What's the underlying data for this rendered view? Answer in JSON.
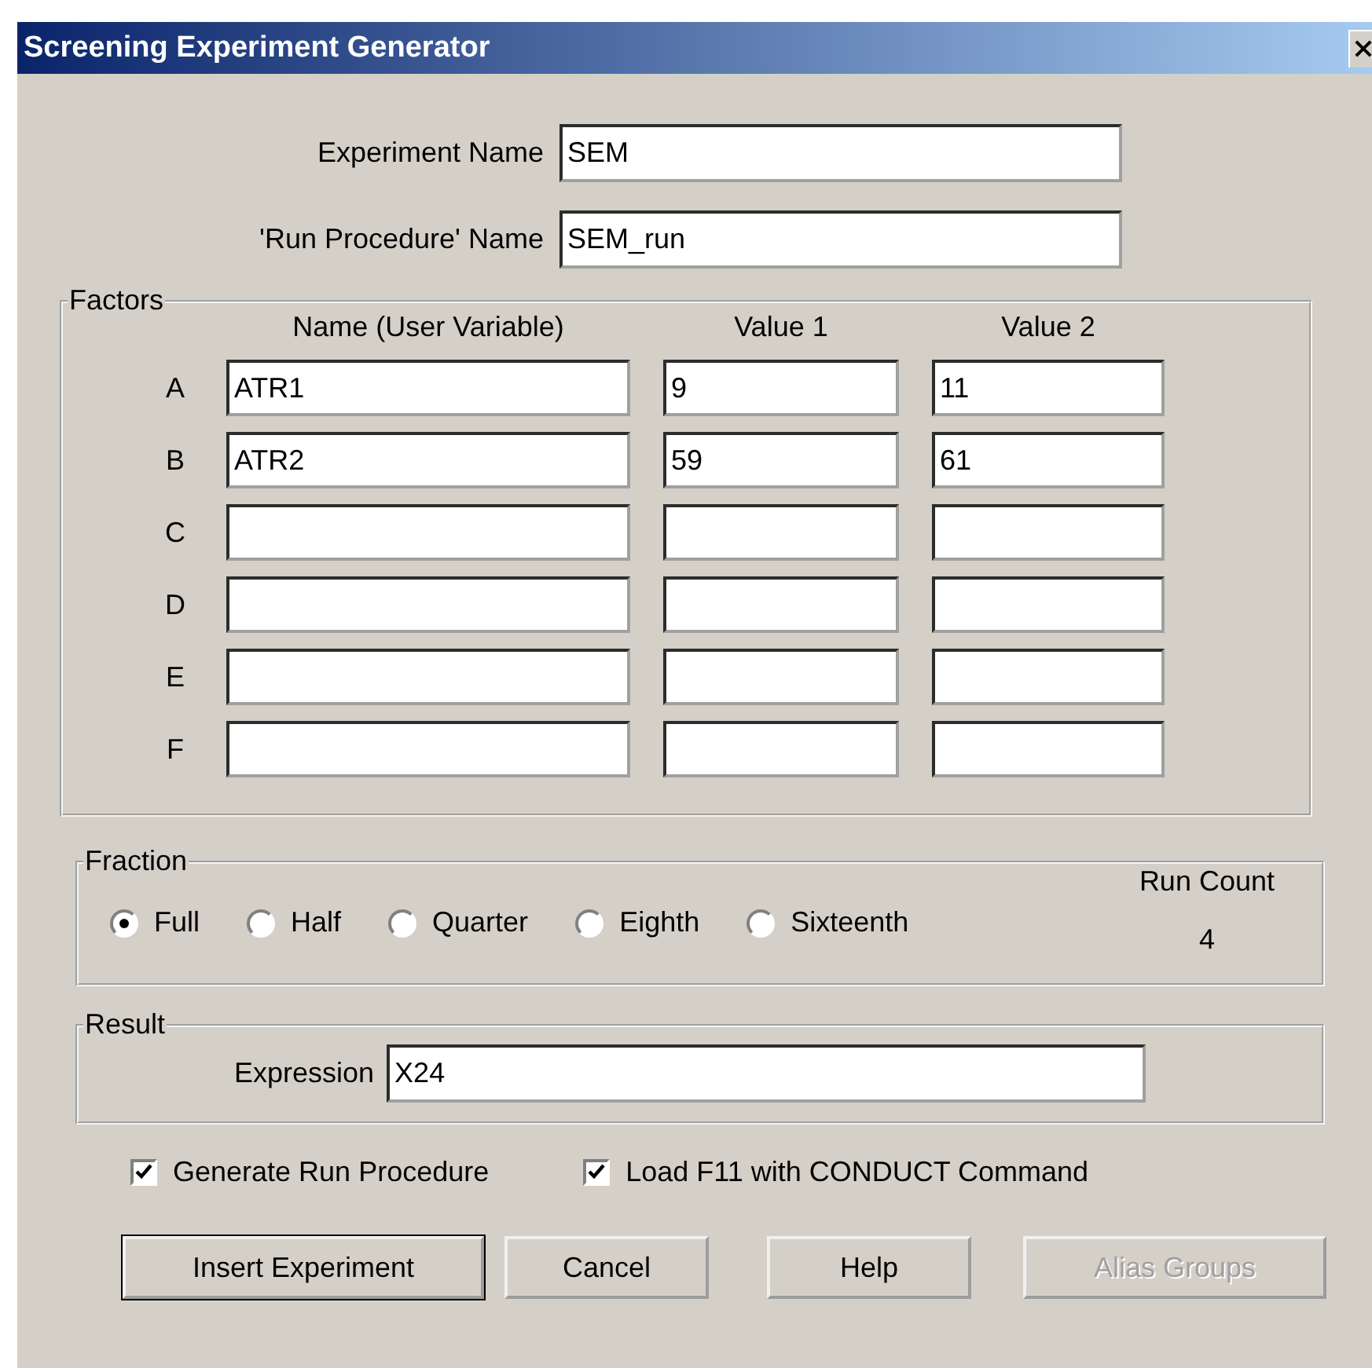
{
  "window": {
    "title": "Screening Experiment Generator"
  },
  "experiment_name": {
    "label": "Experiment Name",
    "value": "SEM"
  },
  "run_procedure_name": {
    "label": "'Run Procedure' Name",
    "value": "SEM_run"
  },
  "factors": {
    "title": "Factors",
    "columns": [
      "Name (User Variable)",
      "Value 1",
      "Value 2"
    ],
    "rows": [
      {
        "letter": "A",
        "name": "ATR1",
        "value_1": "9",
        "value_2": "11"
      },
      {
        "letter": "B",
        "name": "ATR2",
        "value_1": "59",
        "value_2": "61"
      },
      {
        "letter": "C"
      },
      {
        "letter": "D"
      },
      {
        "letter": "E"
      },
      {
        "letter": "F"
      }
    ]
  },
  "fraction": {
    "title": "Fraction",
    "options": [
      {
        "label": "Full",
        "selected": true
      },
      {
        "label": "Half",
        "selected": false
      },
      {
        "label": "Quarter",
        "selected": false
      },
      {
        "label": "Eighth",
        "selected": false
      },
      {
        "label": "Sixteenth",
        "selected": false
      }
    ],
    "run_count": {
      "label": "Run Count",
      "value": "4"
    }
  },
  "result": {
    "title": "Result",
    "expression": {
      "label": "Expression",
      "value": "X24"
    }
  },
  "options": [
    {
      "label": "Generate Run Procedure",
      "checked": true
    },
    {
      "label": "Load F11 with CONDUCT Command",
      "checked": true
    }
  ],
  "buttons": [
    {
      "label": "Insert Experiment",
      "default": true,
      "disabled": false
    },
    {
      "label": "Cancel",
      "default": false,
      "disabled": false
    },
    {
      "label": "Help",
      "default": false,
      "disabled": false
    },
    {
      "label": "Alias Groups",
      "default": false,
      "disabled": true
    }
  ]
}
